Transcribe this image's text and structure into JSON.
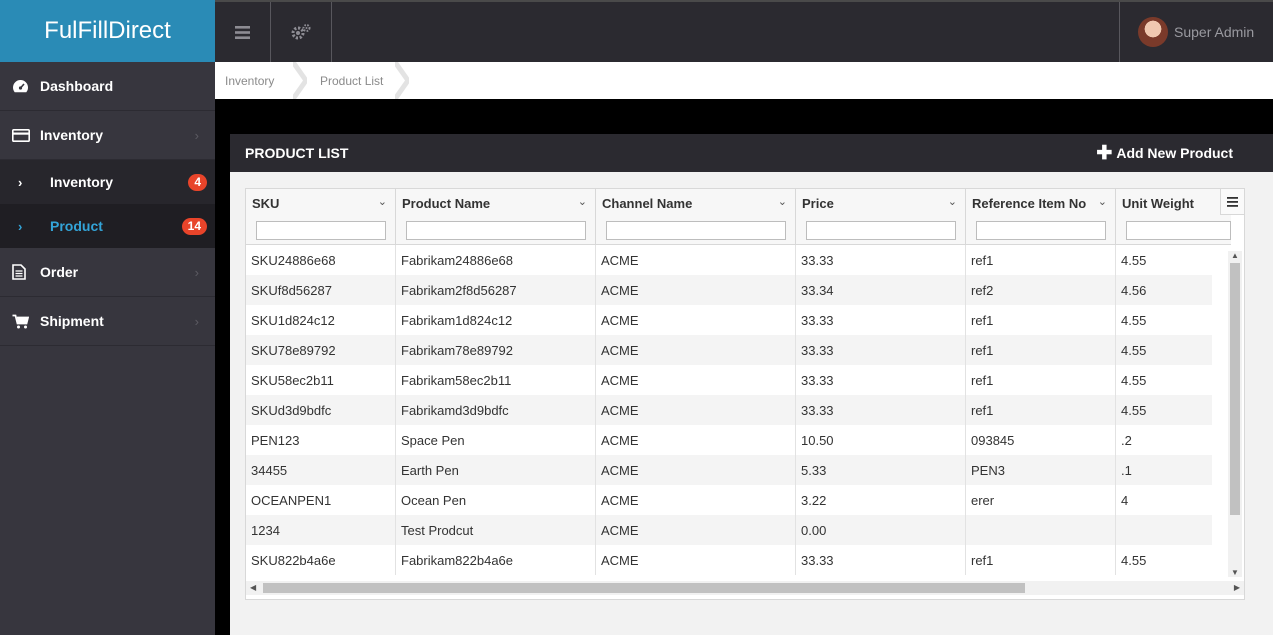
{
  "app": {
    "brand": "FulFillDirect"
  },
  "sidebar": {
    "dashboard": "Dashboard",
    "inventory": "Inventory",
    "sub_inventory": {
      "label": "Inventory",
      "badge": "4"
    },
    "sub_product": {
      "label": "Product",
      "badge": "14"
    },
    "order": "Order",
    "shipment": "Shipment"
  },
  "topbar": {
    "user": "Super Admin"
  },
  "breadcrumb": [
    "Inventory",
    "Product List"
  ],
  "panel": {
    "title": "PRODUCT LIST",
    "add_label": "Add New Product"
  },
  "grid": {
    "columns": [
      "SKU",
      "Product Name",
      "Channel Name",
      "Price",
      "Reference Item No",
      "Unit Weight"
    ],
    "rows": [
      [
        "SKU24886e68",
        "Fabrikam24886e68",
        "ACME",
        "33.33",
        "ref1",
        "4.55"
      ],
      [
        "SKUf8d56287",
        "Fabrikam2f8d56287",
        "ACME",
        "33.34",
        "ref2",
        "4.56"
      ],
      [
        "SKU1d824c12",
        "Fabrikam1d824c12",
        "ACME",
        "33.33",
        "ref1",
        "4.55"
      ],
      [
        "SKU78e89792",
        "Fabrikam78e89792",
        "ACME",
        "33.33",
        "ref1",
        "4.55"
      ],
      [
        "SKU58ec2b11",
        "Fabrikam58ec2b11",
        "ACME",
        "33.33",
        "ref1",
        "4.55"
      ],
      [
        "SKUd3d9bdfc",
        "Fabrikamd3d9bdfc",
        "ACME",
        "33.33",
        "ref1",
        "4.55"
      ],
      [
        "PEN123",
        "Space Pen",
        "ACME",
        "10.50",
        "093845",
        ".2"
      ],
      [
        "34455",
        "Earth Pen",
        "ACME",
        "5.33",
        "PEN3",
        ".1"
      ],
      [
        "OCEANPEN1",
        "Ocean Pen",
        "ACME",
        "3.22",
        "erer",
        "4"
      ],
      [
        "1234",
        "Test Prodcut",
        "ACME",
        "0.00",
        "",
        ""
      ],
      [
        "SKU822b4a6e",
        "Fabrikam822b4a6e",
        "ACME",
        "33.33",
        "ref1",
        "4.55"
      ]
    ]
  },
  "colors": {
    "brand": "#2a8bb6",
    "active_link": "#33a4d8",
    "badge": "#e8442a",
    "dark": "#2b2a30"
  }
}
